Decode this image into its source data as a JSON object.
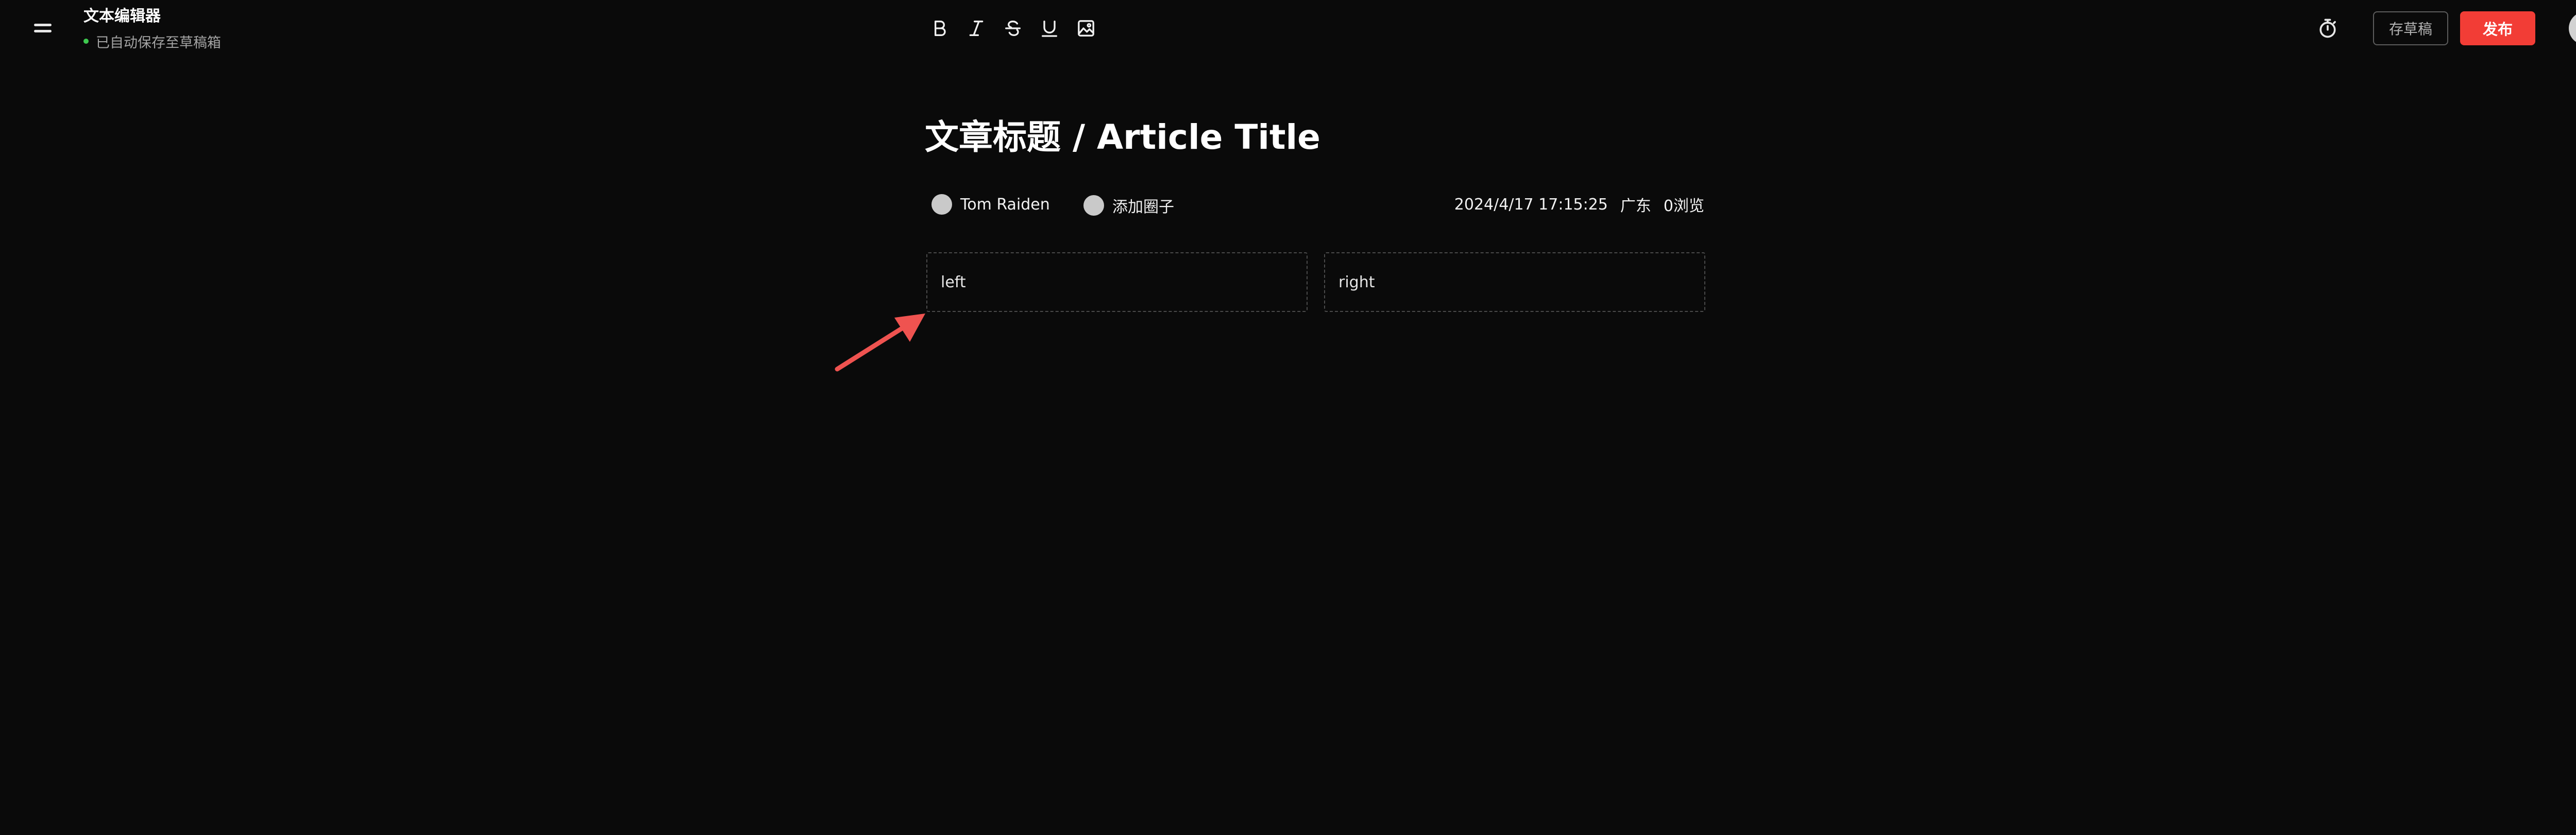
{
  "header": {
    "menu_icon": "hamburger-menu-icon",
    "app_title": "文本编辑器",
    "save_status": "已自动保存至草稿箱",
    "status_color": "#3ec94f",
    "toolbar": [
      {
        "name": "bold-icon",
        "label": "B"
      },
      {
        "name": "italic-icon",
        "label": "I"
      },
      {
        "name": "strikethrough-icon",
        "label": "S"
      },
      {
        "name": "underline-icon",
        "label": "U"
      },
      {
        "name": "image-icon",
        "label": "image"
      }
    ],
    "timer_icon": "stopwatch-icon",
    "draft_label": "存草稿",
    "publish_label": "发布",
    "publish_color": "#f23d36"
  },
  "article": {
    "title": "文章标题 / Article Title",
    "author_name": "Tom Raiden",
    "circle_label": "添加圈子",
    "datetime": "2024/4/17 17:15:25",
    "location": "广东",
    "views": "0浏览"
  },
  "columns": {
    "left": "left",
    "right": "right"
  },
  "annotation": {
    "arrow_color": "#ef5350"
  }
}
